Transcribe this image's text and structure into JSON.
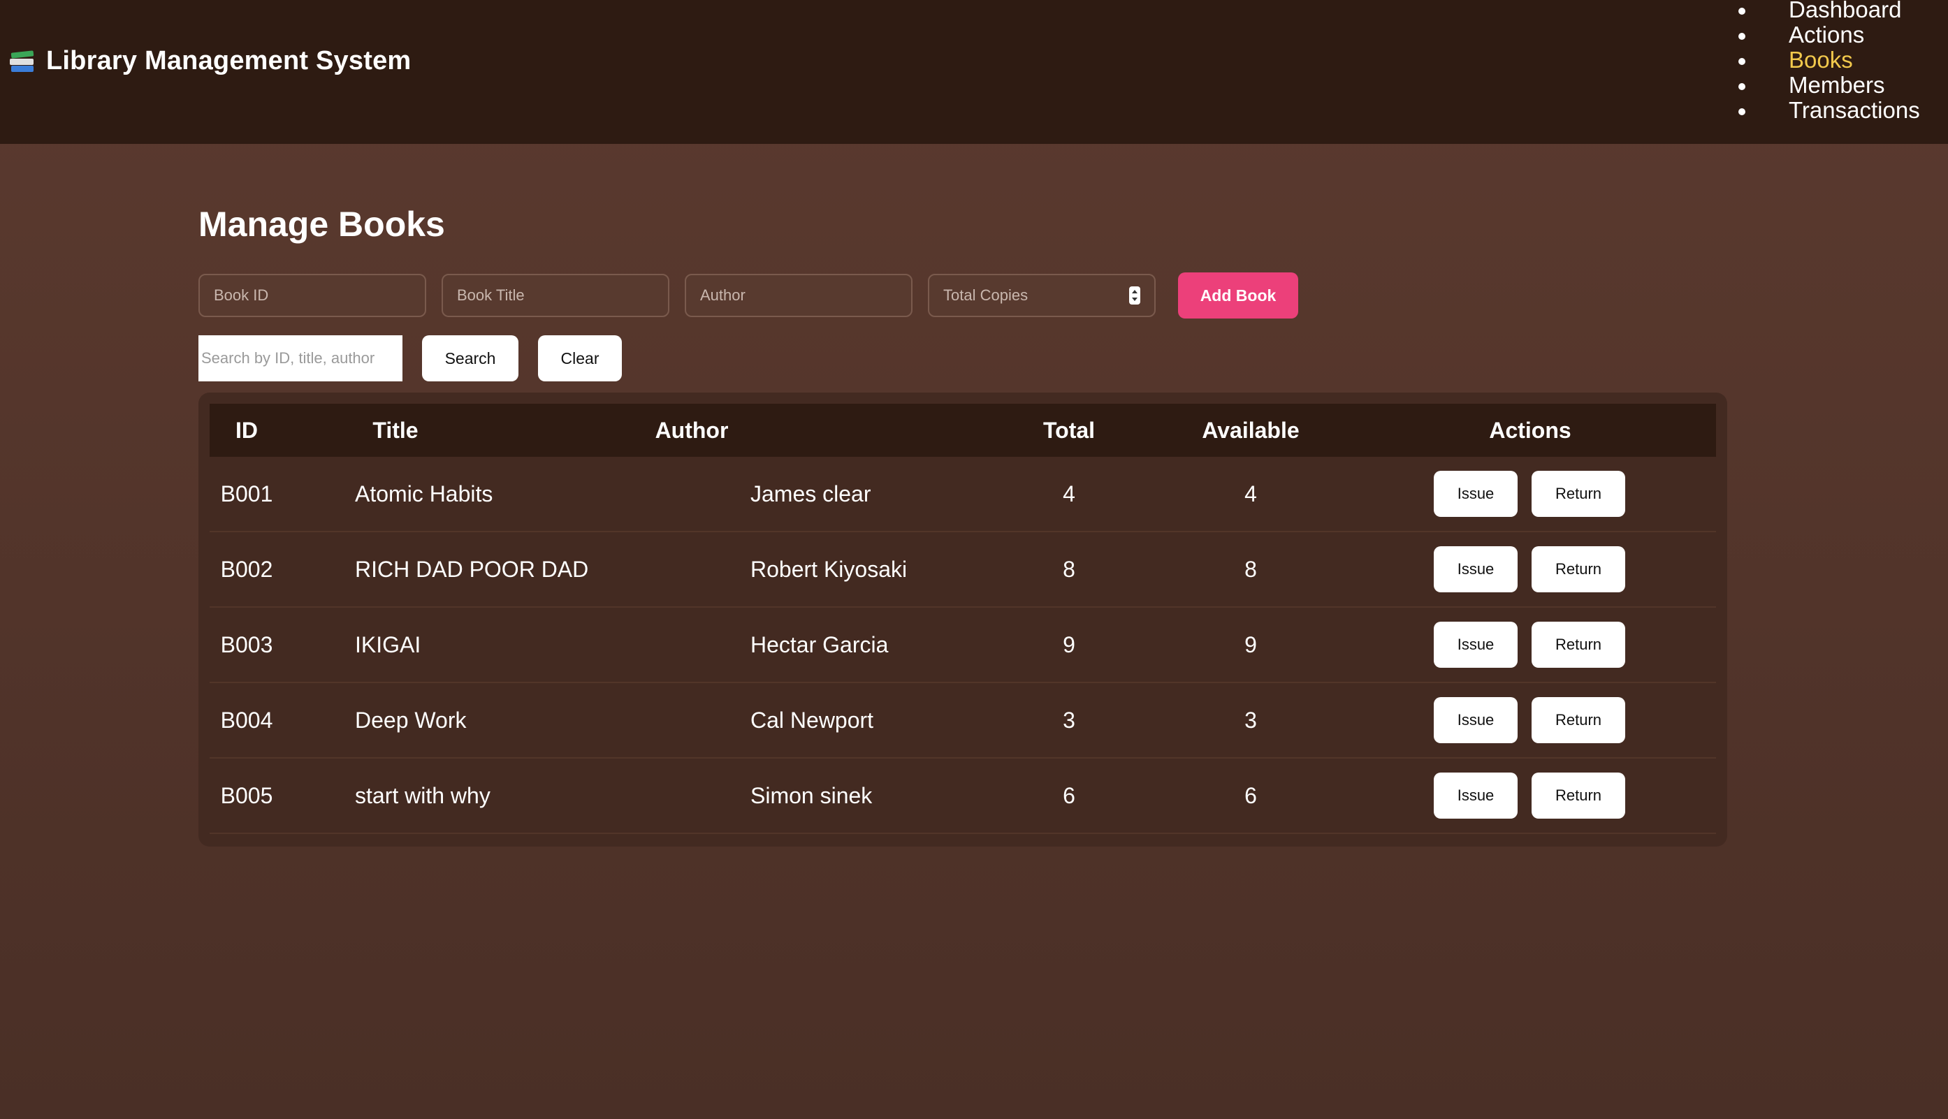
{
  "header": {
    "title": "Library Management System",
    "icon": "books-icon",
    "nav": [
      {
        "label": "Dashboard",
        "active": false
      },
      {
        "label": "Actions",
        "active": false
      },
      {
        "label": "Books",
        "active": true
      },
      {
        "label": "Members",
        "active": false
      },
      {
        "label": "Transactions",
        "active": false
      }
    ],
    "active_color": "#f2c94c"
  },
  "main": {
    "title": "Manage Books",
    "form": {
      "book_id_placeholder": "Book ID",
      "book_title_placeholder": "Book Title",
      "author_placeholder": "Author",
      "total_copies_placeholder": "Total Copies",
      "add_button": "Add Book",
      "add_button_color": "#ec407a"
    },
    "search": {
      "placeholder": "Search by ID, title, author",
      "search_button": "Search",
      "clear_button": "Clear"
    },
    "table": {
      "columns": [
        "ID",
        "Title",
        "Author",
        "Total",
        "Available",
        "Actions"
      ],
      "rows": [
        {
          "id": "B001",
          "title": "Atomic Habits",
          "author": "James clear",
          "total": "4",
          "available": "4"
        },
        {
          "id": "B002",
          "title": "RICH DAD POOR DAD",
          "author": "Robert Kiyosaki",
          "total": "8",
          "available": "8"
        },
        {
          "id": "B003",
          "title": "IKIGAI",
          "author": "Hectar Garcia",
          "total": "9",
          "available": "9"
        },
        {
          "id": "B004",
          "title": "Deep Work",
          "author": "Cal Newport",
          "total": "3",
          "available": "3"
        },
        {
          "id": "B005",
          "title": "start with why",
          "author": "Simon sinek",
          "total": "6",
          "available": "6"
        }
      ],
      "issue_label": "Issue",
      "return_label": "Return"
    }
  }
}
